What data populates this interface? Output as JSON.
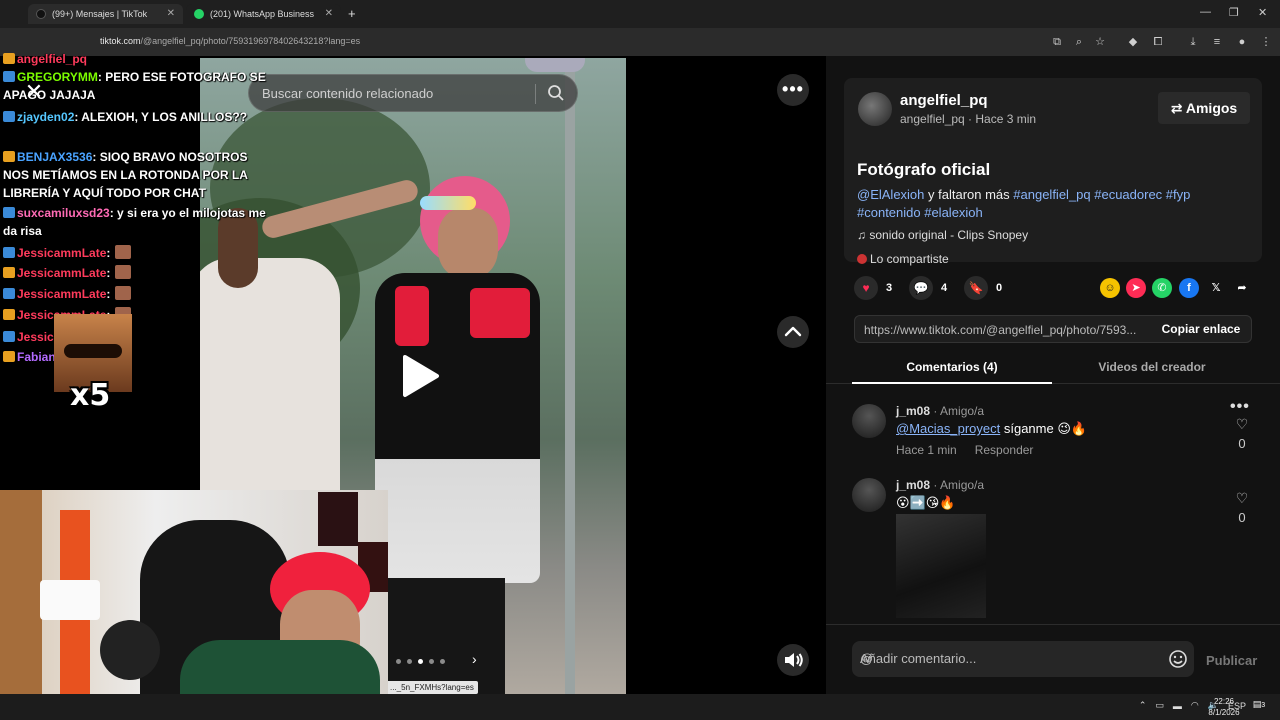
{
  "browser": {
    "tabs": [
      {
        "label": "(99+) Mensajes | TikTok",
        "active": false
      },
      {
        "label": "(201) WhatsApp Business",
        "active": false
      }
    ],
    "new_tab": "+",
    "url_host": "tiktok.com",
    "url_path": "/@angelfiel_pq/photo/7593196978402643218?lang=es"
  },
  "photo": {
    "search_placeholder": "Buscar contenido relacionado",
    "close_glyph": "✕",
    "more_glyph": "•••",
    "status_url": "..._5n_FXMHs?lang=es"
  },
  "stream_chat": [
    {
      "user": "angelfiel_pq",
      "user_color": "#ff3b5c",
      "text": ""
    },
    {
      "user": "GREGORYMM",
      "user_color": "#7cfc00",
      "text": ": PERO ESE FOTOGRAFO SE"
    },
    {
      "user": "",
      "user_color": "#fff",
      "text": "APAGO JAJAJA"
    },
    {
      "user": "zjayden02",
      "user_color": "#55c7ff",
      "text": ": ALEXIOH, Y LOS ANILLOS??"
    },
    {
      "user": "BENJAX3536",
      "user_color": "#4aa3ff",
      "text": ": SIOQ BRAVO NOSOTROS"
    },
    {
      "user": "",
      "user_color": "#fff",
      "text": "NOS METÍAMOS EN LA ROTONDA POR LA"
    },
    {
      "user": "",
      "user_color": "#fff",
      "text": "LIBRERÍA Y AQUÍ TODO POR CHAT"
    },
    {
      "user": "suxcamiluxsd23",
      "user_color": "#ff6bb5",
      "text": ": y si era yo el milojotas me"
    },
    {
      "user": "",
      "user_color": "#fff",
      "text": "da risa"
    },
    {
      "user": "JessicammLate",
      "user_color": "#ff3b5c",
      "text": ":"
    },
    {
      "user": "JessicammLate",
      "user_color": "#ff3b5c",
      "text": ":"
    },
    {
      "user": "JessicammLate",
      "user_color": "#ff3b5c",
      "text": ":"
    },
    {
      "user": "JessicammLate",
      "user_color": "#ff3b5c",
      "text": ":"
    },
    {
      "user": "JessicammLate",
      "user_color": "#ff3b5c",
      "text": ":"
    },
    {
      "user": "Fabianaap_77",
      "user_color": "#b36bff",
      "text": ":"
    }
  ],
  "meme_label": "x5",
  "post": {
    "username": "angelfiel_pq",
    "subtitle": "angelfiel_pq · Hace 3 min",
    "friends_button": "Amigos",
    "title": "Fotógrafo oficial",
    "caption_mention": "@ElAlexioh",
    "caption_text": " y faltaron más ",
    "caption_tags_1": "#angelfiel_pq #ecuadorec #fyp",
    "caption_tags_2": "#contenido #elalexioh",
    "sound": "sonido original - Clips Snopey",
    "shared_by": "Lo compartiste"
  },
  "actions": {
    "likes": "3",
    "comments": "4",
    "saves": "0"
  },
  "share": {
    "link": "https://www.tiktok.com/@angelfiel_pq/photo/7593...",
    "copy_button": "Copiar enlace"
  },
  "tabs": {
    "comments": "Comentarios (4)",
    "videos": "Videos del creador"
  },
  "comments": [
    {
      "user": "j_m08",
      "relation": "· Amigo/a",
      "mention": "@Macias_proyect",
      "text": " síganme 😉🔥",
      "time": "Hace 1 min",
      "reply": "Responder",
      "likes": "0"
    },
    {
      "user": "j_m08",
      "relation": "· Amigo/a",
      "mention": "",
      "text": "😮➡️😘🔥",
      "time": "",
      "reply": "",
      "likes": "0"
    }
  ],
  "composer": {
    "placeholder": "Añadir comentario...",
    "at": "@",
    "publish": "Publicar"
  },
  "taskbar": {
    "lang": "ESP",
    "time": "22:26",
    "date": "8/1/2026",
    "notif_count": "3"
  },
  "colors": {
    "accent_red": "#fe2c55",
    "link_blue": "#8ab4f8",
    "panel_bg": "#121212"
  }
}
